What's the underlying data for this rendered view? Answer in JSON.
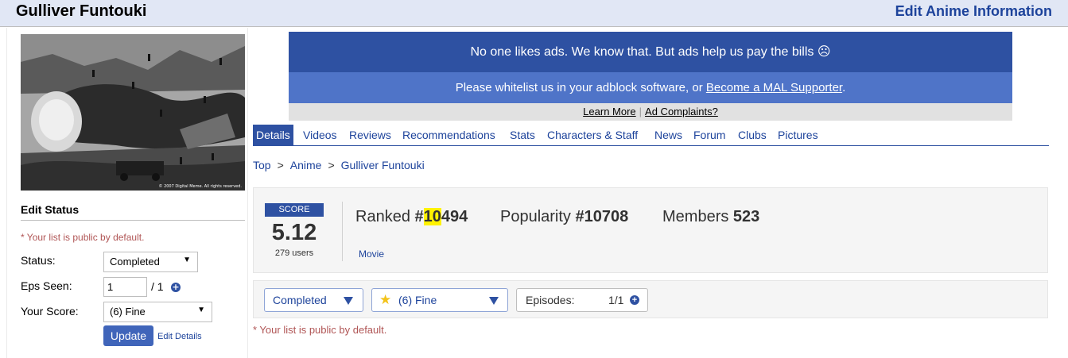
{
  "header": {
    "title": "Gulliver Funtouki",
    "edit_link": "Edit Anime Information"
  },
  "cover": {
    "caption": "© 2007 Digital Meme. All rights reserved."
  },
  "edit_status": {
    "title": "Edit Status",
    "public_note": "* Your list is public by default.",
    "status_label": "Status:",
    "status_value": "Completed",
    "eps_label": "Eps Seen:",
    "eps_value": "1",
    "eps_total": "/ 1",
    "score_label": "Your Score:",
    "score_value": "(6) Fine",
    "update_button": "Update",
    "edit_details": "Edit Details"
  },
  "ad": {
    "line1": "No one likes ads. We know that. But ads help us pay the bills ☹",
    "line2_prefix": "Please whitelist us in your adblock software, or ",
    "line2_link": "Become a MAL Supporter",
    "line2_suffix": ".",
    "learn_more": "Learn More",
    "separator": "|",
    "complaints": "Ad Complaints?"
  },
  "tabs": [
    "Details",
    "Videos",
    "Reviews",
    "Recommendations",
    "Stats",
    "Characters & Staff",
    "News",
    "Forum",
    "Clubs",
    "Pictures"
  ],
  "breadcrumb": [
    "Top",
    "Anime",
    "Gulliver Funtouki"
  ],
  "breadcrumb_sep": ">",
  "stats": {
    "score_label": "SCORE",
    "score": "5.12",
    "users": "279 users",
    "ranked_label": "Ranked",
    "ranked_hash": "#",
    "ranked_highlight": "10",
    "ranked_rest": "494",
    "popularity_label": "Popularity",
    "popularity_value": "#10708",
    "members_label": "Members",
    "members_value": "523",
    "type": "Movie"
  },
  "list_bar": {
    "status": "Completed",
    "score": "(6) Fine",
    "episodes_label": "Episodes:",
    "episodes_value": "1/1"
  },
  "public_note_main": "* Your list is public by default.",
  "colors": {
    "accent": "#2e51a2",
    "link": "#1d439b",
    "header_bg": "#e1e7f5",
    "note": "#b05555"
  }
}
